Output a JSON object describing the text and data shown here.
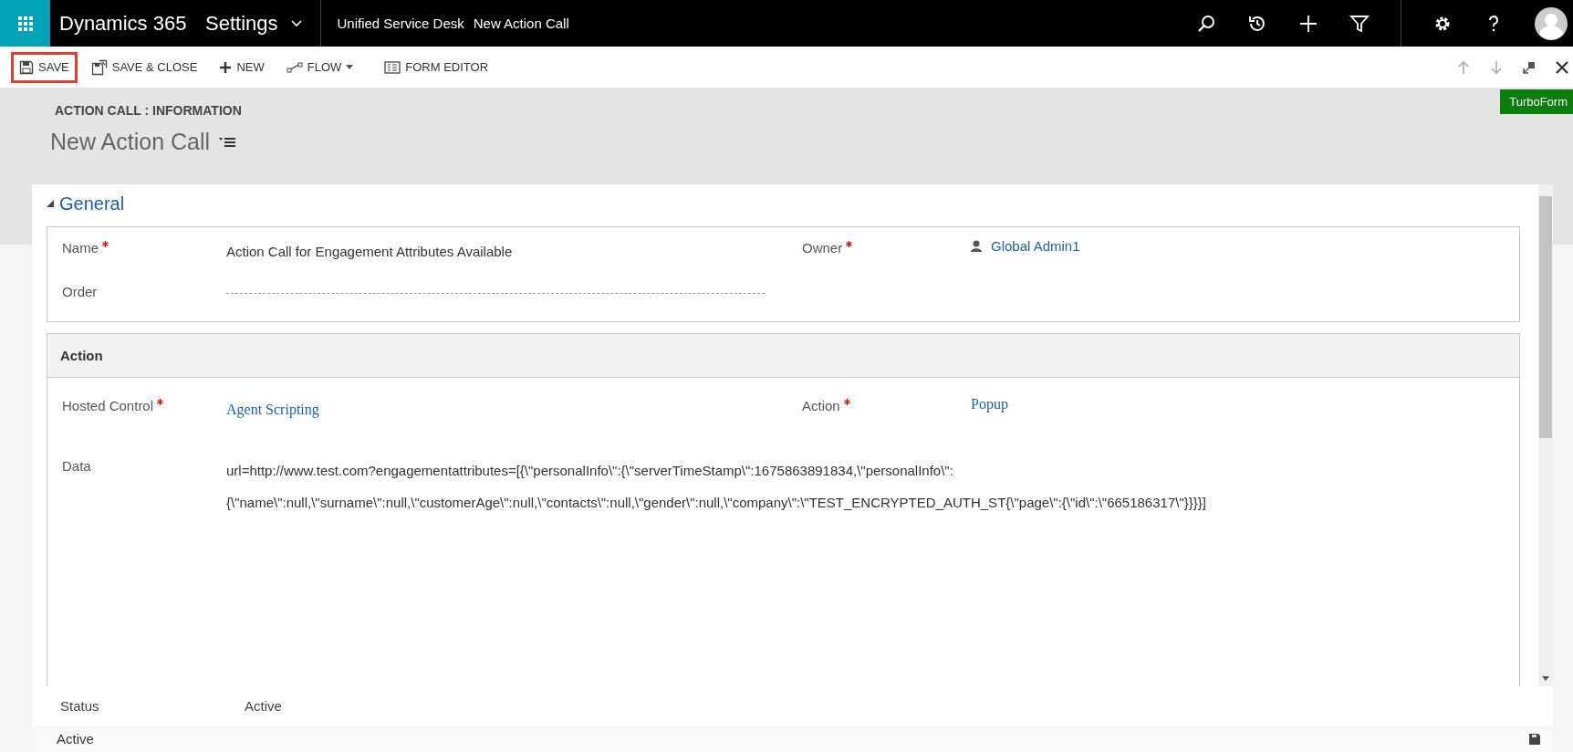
{
  "top_bar": {
    "app_name": "Dynamics 365",
    "area": "Settings",
    "breadcrumbs": [
      "Unified Service Desk",
      "New Action Call"
    ]
  },
  "toolbar": [
    {
      "kind": "save",
      "label": "SAVE",
      "highlighted": true,
      "has_menu": false
    },
    {
      "kind": "save_close",
      "label": "SAVE & CLOSE",
      "highlighted": false,
      "has_menu": false
    },
    {
      "kind": "new",
      "label": "NEW",
      "highlighted": false,
      "has_menu": false
    },
    {
      "kind": "flow",
      "label": "FLOW",
      "highlighted": false,
      "has_menu": true
    },
    {
      "kind": "form_editor",
      "label": "FORM EDITOR",
      "highlighted": false,
      "has_menu": false
    }
  ],
  "badge": "TurboForm",
  "header": {
    "entity_label": "ACTION CALL : INFORMATION",
    "title": "New Action Call"
  },
  "general": {
    "title": "General",
    "expanded": true,
    "rows": [
      [
        {
          "label": "Name",
          "required": true,
          "kind": "text",
          "value": "Action Call for Engagement Attributes Available"
        },
        {
          "label": "Owner",
          "required": true,
          "kind": "user",
          "value": "Global Admin1"
        }
      ],
      [
        {
          "label": "Order",
          "required": false,
          "kind": "empty"
        }
      ]
    ]
  },
  "action": {
    "title": "Action",
    "rows": [
      [
        {
          "label": "Hosted Control",
          "required": true,
          "kind": "link",
          "value": "Agent Scripting"
        },
        {
          "label": "Action",
          "required": true,
          "kind": "link",
          "value": "Popup"
        }
      ],
      [
        {
          "label": "Data",
          "required": false,
          "kind": "multiline",
          "lines": [
            "url=http://www.test.com?engagementattributes=[{\\\"personalInfo\\\":{\\\"serverTimeStamp\\\":1675863891834,\\\"personalInfo\\\":",
            "{\\\"name\\\":null,\\\"surname\\\":null,\\\"customerAge\\\":null,\\\"contacts\\\":null,\\\"gender\\\":null,\\\"company\\\":\\\"TEST_ENCRYPTED_AUTH_ST{\\\"page\\\":{\\\"id\\\":\\\"665186317\\\"}}}}]"
          ]
        }
      ]
    ]
  },
  "status": {
    "label": "Status",
    "value": "Active"
  },
  "status_bar": {
    "text": "Active"
  }
}
